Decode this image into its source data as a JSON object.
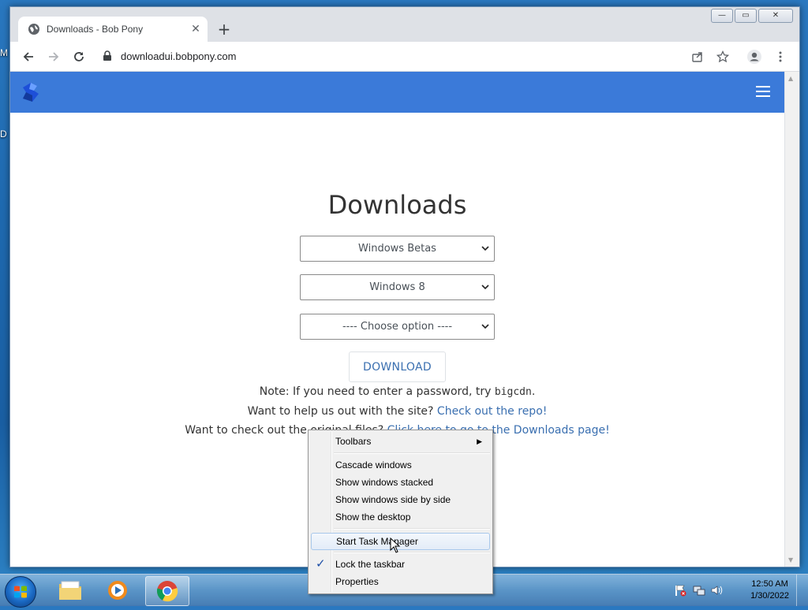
{
  "desktop": {
    "frag1": "M",
    "frag2": "D"
  },
  "browser": {
    "tab_title": "Downloads - Bob Pony",
    "tab_close": "✕",
    "new_tab": "+",
    "url": "downloadui.bobpony.com",
    "window_buttons": {
      "minimize": "—",
      "maximize": "▭",
      "close": "✕"
    }
  },
  "page": {
    "title": "Downloads",
    "select_category": "Windows Betas",
    "select_version": "Windows 8",
    "select_option": "---- Choose option ----",
    "download_button": "DOWNLOAD",
    "note_prefix": "Note: If you need to enter a password, try ",
    "note_code": "bigcdn",
    "note_suffix": ".",
    "help_prefix": "Want to help us out with the site? ",
    "help_link": "Check out the repo!",
    "orig_prefix": "Want to check out the original files? ",
    "orig_link": "Click here to go to the Downloads page!",
    "brand_color": "#3b7ad9",
    "link_color": "#3a6fb0"
  },
  "context_menu": {
    "toolbars": "Toolbars",
    "toolbars_arrow": "▶",
    "cascade": "Cascade windows",
    "stacked": "Show windows stacked",
    "side_by_side": "Show windows side by side",
    "show_desktop": "Show the desktop",
    "task_manager": "Start Task Manager",
    "lock_taskbar": "Lock the taskbar",
    "lock_check": "✓",
    "properties": "Properties"
  },
  "taskbar": {
    "time": "12:50 AM",
    "date": "1/30/2022",
    "apps": [
      "explorer-icon",
      "media-player-icon",
      "chrome-icon"
    ]
  }
}
